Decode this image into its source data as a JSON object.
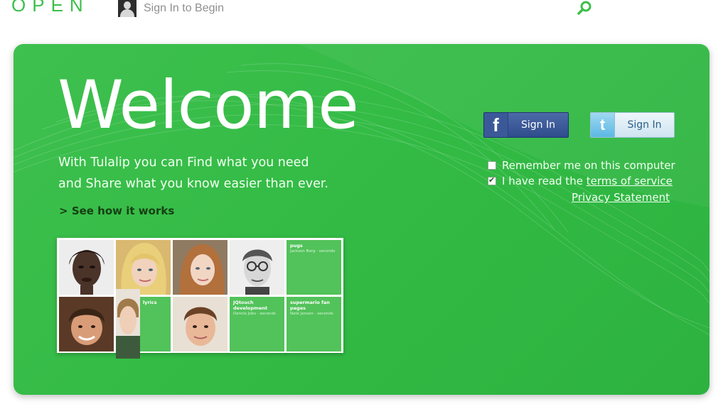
{
  "header": {
    "brand": "OPEN",
    "signin_prompt": "Sign In to Begin",
    "icons": {
      "user": "user-silhouette-icon",
      "search": "search-icon"
    }
  },
  "hero": {
    "title": "Welcome",
    "tagline_line1": "With Tulalip you can Find what you need",
    "tagline_line2": "and Share what you know easier than ever.",
    "see_how_prefix": ">",
    "see_how": "See how it works"
  },
  "mosaic": {
    "tiles": [
      {
        "title": "pugs",
        "subtitle": "Jackson Berg · seconds"
      },
      {
        "title": "lyrics",
        "subtitle": ""
      },
      {
        "title": "JQtouch development",
        "subtitle": "Dennis Jobs · seconds"
      },
      {
        "title": "supermario fan pages",
        "subtitle": "Nate Jensen · seconds"
      }
    ]
  },
  "auth": {
    "facebook_label": "Sign In",
    "twitter_label": "Sign In",
    "remember_label": "Remember me on this computer",
    "remember_checked": false,
    "terms_prefix": "I have read the",
    "terms_link": "terms of service",
    "terms_checked": true,
    "privacy_link": "Privacy Statement"
  },
  "colors": {
    "brand_green": "#3cbf4a",
    "panel_green": "#33bb45",
    "facebook_blue": "#3b5998",
    "twitter_blue": "#5cb8e3"
  }
}
